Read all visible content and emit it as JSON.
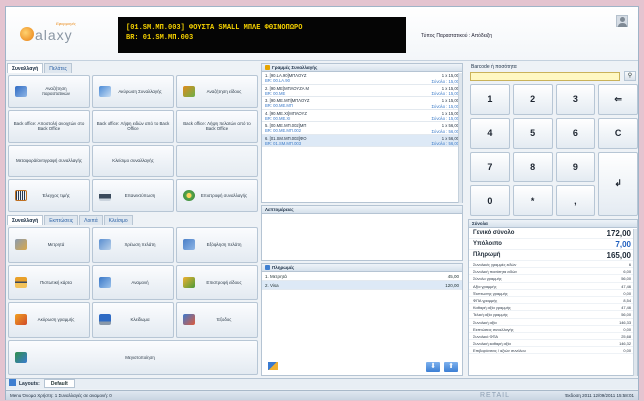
{
  "header": {
    "logo_text": "alaxy",
    "logo_tag": "Εφαρμογές",
    "display_line1": "[01.SM.ΜΠ.003] ΦΟΥΣΤΑ SMALL ΜΠΛΕ ΦΘΙΝΟΠΩΡΟ",
    "display_line2": "BR: 01.SM.ΜΠ.003",
    "doc_type": "Τύπος Παραστατικού : Απόδειξη"
  },
  "top_tabs": [
    "Συναλλαγή",
    "Πελάτες"
  ],
  "top_buttons": [
    {
      "label": "Αναζήτηση παραστατικών",
      "icon": "binoculars-icon"
    },
    {
      "label": "Ακύρωση Συναλλαγής",
      "icon": "cancel-transaction-icon"
    },
    {
      "label": "Αναζήτηση είδους",
      "icon": "item-search-icon"
    },
    {
      "label": "Back office: Αποστολή ανοιχτών στο Back Office",
      "icon": ""
    },
    {
      "label": "Back office: Λήψη ειδών από το Back Office",
      "icon": ""
    },
    {
      "label": "Back office: Λήψη πελατών από το Back Office",
      "icon": ""
    },
    {
      "label": "Μεταφορά/αντιγραφή συναλλαγής",
      "icon": ""
    },
    {
      "label": "Κλείσιμο συναλλαγής",
      "icon": ""
    },
    {
      "label": "",
      "icon": ""
    },
    {
      "label": "Έλεγχος τιμής",
      "icon": "barcode-icon"
    },
    {
      "label": "Επανεκτύπωση",
      "icon": "printer-icon"
    },
    {
      "label": "Επιστροφή συναλλαγής",
      "icon": "return-icon"
    }
  ],
  "bottom_tabs": [
    "Συναλλαγή",
    "Εκπτώσεις",
    "Λοιπά",
    "Κλείσιμο"
  ],
  "bottom_buttons": [
    {
      "label": "Μετρητά",
      "icon": "cash-icon"
    },
    {
      "label": "Χρέωση πελάτη",
      "icon": "customer-charge-icon"
    },
    {
      "label": "Εξόφληση πελάτη",
      "icon": "customer-payoff-icon"
    },
    {
      "label": "Πιστωτική κάρτα",
      "icon": "credit-card-icon"
    },
    {
      "label": "Αναμονή",
      "icon": "hold-icon"
    },
    {
      "label": "Επιστροφή είδους",
      "icon": "item-return-icon"
    },
    {
      "label": "Ακύρωση γραμμής",
      "icon": "cancel-line-icon"
    },
    {
      "label": "Κλείδωμα",
      "icon": "lock-screen-icon"
    },
    {
      "label": "Έξοδος",
      "icon": "exit-icon"
    },
    {
      "label": "Μεγιστοποίηση",
      "icon": "maximize-icon"
    }
  ],
  "lines_panel": {
    "title": "Γραμμές Συναλλαγής",
    "rows": [
      {
        "name": "1. [90.LA.90]ΜΠΛΟΥΖ",
        "code": "BR: 00.LA.90",
        "qty": "1 x 15,00",
        "sum": "Σύνολο : 15,00"
      },
      {
        "name": "2. [90.ΜΕ]ΜΠΛΟΥΖΑ Μ",
        "code": "BR: 00.ME",
        "qty": "1 x 15,00",
        "sum": "Σύνολο : 15,00"
      },
      {
        "name": "3. [90.ΜΕ.ΜΠ]ΜΠΛΟΥΖ",
        "code": "BR: 00.ΜΕ.ΜΠ",
        "qty": "1 x 15,00",
        "sum": "Σύνολο : 15,00"
      },
      {
        "name": "4. [90.ΜΕ.ΧΙ]ΜΠΛΟΥΖ",
        "code": "BR: 00.ΜΕ.ΧΙ",
        "qty": "1 x 15,00",
        "sum": "Σύνολο : 15,00"
      },
      {
        "name": "5. [00.ΜΕ.ΜΠ.002]ΜΠ",
        "code": "BR: 00.ΜΕ.ΜΠ.002",
        "qty": "1 x 56,00",
        "sum": "Σύνολο : 56,00"
      },
      {
        "name": "6. [01.SM.ΜΠ.003]ΦΟ",
        "code": "BR: 01.SM.ΜΠ.003",
        "qty": "1 x 56,00",
        "sum": "Σύνολο : 56,00"
      }
    ]
  },
  "details_panel": {
    "title": "Λεπτομέρειες"
  },
  "payments_panel": {
    "title": "Πληρωμές",
    "rows": [
      {
        "label": "1. Μετρητά",
        "value": "45,00"
      },
      {
        "label": "2. Visa",
        "value": "120,00"
      }
    ]
  },
  "barcode": {
    "label": "Barcode ή ποσότητα",
    "value": ""
  },
  "keypad": [
    "1",
    "2",
    "3",
    "⇐",
    "4",
    "5",
    "6",
    "C",
    "7",
    "8",
    "9",
    "↲",
    "0",
    "*",
    ","
  ],
  "totals": {
    "title": "Σύνολα",
    "big": [
      {
        "label": "Γενικό σύνολο",
        "value": "172,00"
      },
      {
        "label": "Υπόλοιπο",
        "value": "7,00"
      },
      {
        "label": "Πληρωμή",
        "value": "165,00"
      }
    ],
    "rows": [
      {
        "label": "Συνολικές γραμμές ειδών",
        "value": "6"
      },
      {
        "label": "Συνολική ποσότητα ειδών",
        "value": "6,00"
      },
      {
        "label": "Σύνολο γραμμής",
        "value": "56,00"
      },
      {
        "label": "Αξία γραμμής",
        "value": "47,46"
      },
      {
        "label": "Έκπτωσης γραμμής",
        "value": "0,00"
      },
      {
        "label": "ΦΠΑ γραμμής",
        "value": "8,54"
      },
      {
        "label": "Καθαρή αξία γραμμής",
        "value": "47,46"
      },
      {
        "label": "Τελική αξία γραμμής",
        "value": "56,00"
      },
      {
        "label": "Συνολική αξία",
        "value": "146,33"
      },
      {
        "label": "Εκπτώσεις συναλλαγής",
        "value": "0,00"
      },
      {
        "label": "Συνολικό ΦΠΑ",
        "value": "25,68"
      },
      {
        "label": "Συνολική καθαρή αξία",
        "value": "146,32"
      },
      {
        "label": "Επιβαρύνσεις / αξιών συνόλου",
        "value": "0,00"
      }
    ]
  },
  "layouts": {
    "label": "Layouts:",
    "value": "Default"
  },
  "status": {
    "text": "Menu   Όνομα Χρήστη: 1   Συναλλαγές σε αναμονή: 0",
    "brand": "RETAIL",
    "version": "Έκδοση 2011   12/09/2011 15:58:01"
  }
}
